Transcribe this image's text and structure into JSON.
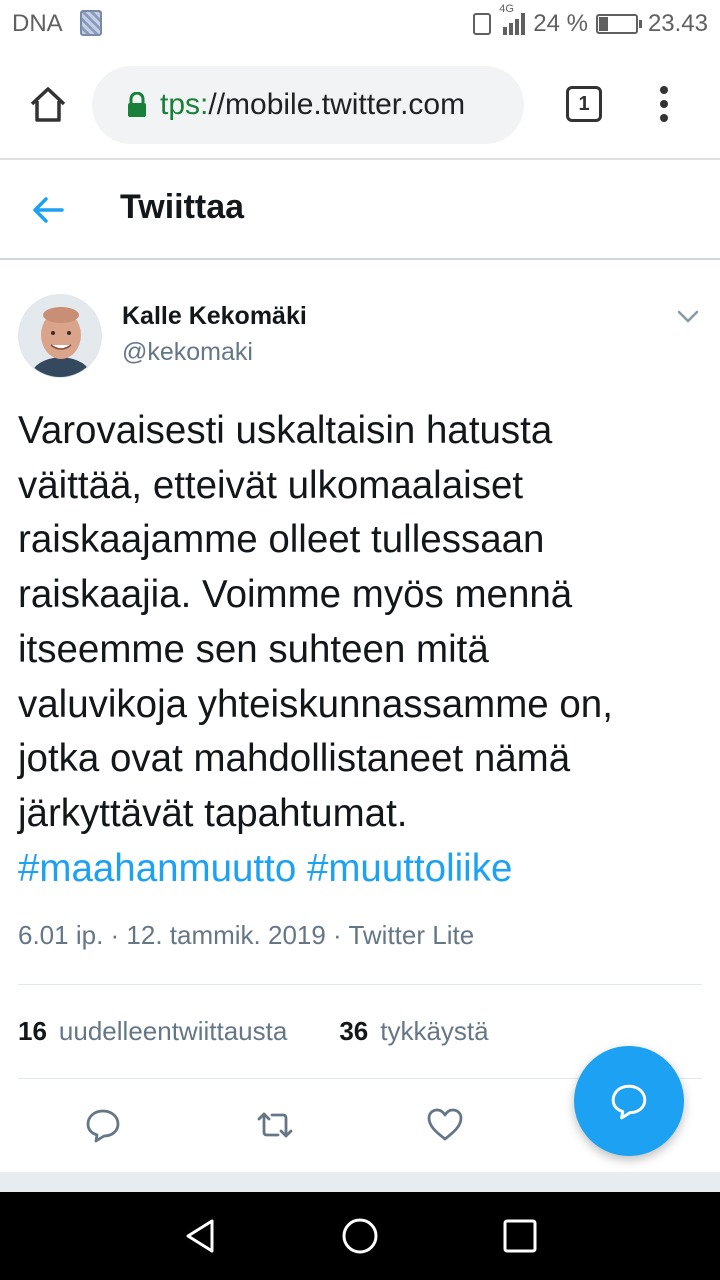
{
  "status_bar": {
    "carrier": "DNA",
    "network": "4G",
    "battery_percent": "24 %",
    "battery_level": 0.24,
    "time": "23.43"
  },
  "browser": {
    "url_scheme_visible": "tps:",
    "url_rest": "//mobile.twitter.com",
    "tab_count": "1"
  },
  "header": {
    "title": "Twiittaa"
  },
  "tweet": {
    "author_name": "Kalle Kekomäki",
    "author_handle": "@kekomaki",
    "text_lines": [
      "Varovaisesti uskaltaisin hatusta",
      "väittää, etteivät ulkomaalaiset",
      "raiskaajamme olleet tullessaan",
      "raiskaajia. Voimme myös mennä",
      "itseemme sen suhteen mitä",
      "valuvikoja yhteiskunnassamme on,",
      "jotka ovat mahdollistaneet nämä",
      "järkyttävät tapahtumat."
    ],
    "hashtags": [
      "#maahanmuutto",
      "#muuttoliike"
    ],
    "meta": "6.01 ip. · 12. tammik. 2019 · Twitter Lite",
    "retweets_count": "16",
    "retweets_label": "uudelleentwiittausta",
    "likes_count": "36",
    "likes_label": "tykkäystä"
  },
  "colors": {
    "accent": "#1da1f2",
    "secure_green": "#188038",
    "secondary_text": "#657786"
  },
  "icons": {
    "home": "home-icon",
    "lock": "lock-icon",
    "tabs": "tabs-icon",
    "menu": "more-vert-icon",
    "back": "arrow-left-icon",
    "caret": "chevron-down-icon",
    "reply": "reply-icon",
    "retweet": "retweet-icon",
    "like": "heart-icon",
    "compose": "compose-icon"
  }
}
